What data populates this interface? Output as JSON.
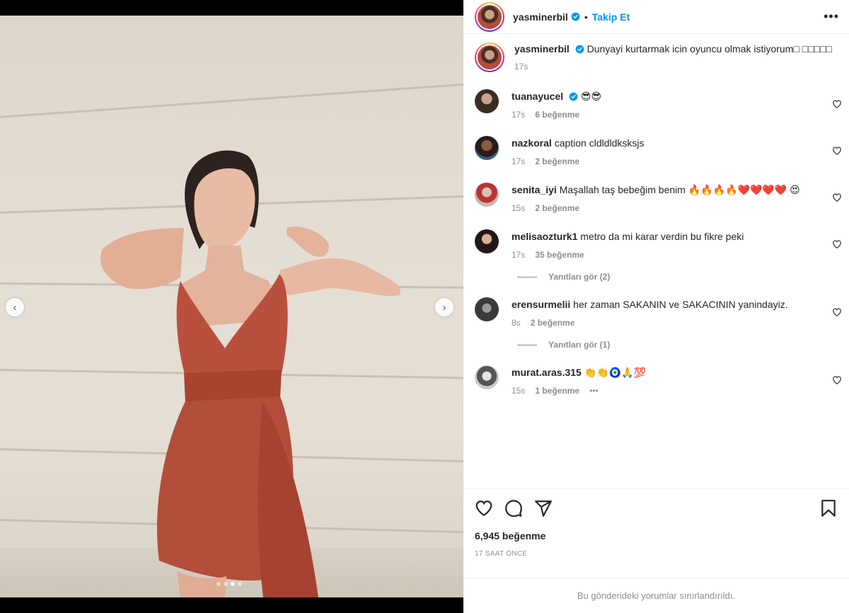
{
  "post": {
    "username": "yasminerbil",
    "follow_label": "Takip Et",
    "separator": "•",
    "more_label": "•••",
    "caption_text": "Dunyayi kurtarmak icin oyuncu olmak istiyorum□ □□□□□",
    "caption_time": "17s"
  },
  "carousel": {
    "prev_icon": "chevron-left-icon",
    "next_icon": "chevron-right-icon",
    "slide_count": 4,
    "active_slide": 3
  },
  "comments": [
    {
      "user": "tuanayucel",
      "verified": true,
      "text": "😎😎",
      "time": "17s",
      "likes": "6 beğenme"
    },
    {
      "user": "nazkoral",
      "verified": false,
      "text": "caption cldldldksksjs",
      "time": "17s",
      "likes": "2 beğenme"
    },
    {
      "user": "senita_iyi",
      "verified": false,
      "text": "Maşallah taş bebeğim benim 🔥🔥🔥🔥❤️❤️❤️❤️ 😍",
      "time": "15s",
      "likes": "2 beğenme"
    },
    {
      "user": "melisaozturk1",
      "verified": false,
      "text": "metro da mi karar verdin bu fikre peki",
      "time": "17s",
      "likes": "35 beğenme",
      "replies": "Yanıtları gör (2)"
    },
    {
      "user": "erensurmelii",
      "verified": false,
      "text": "her zaman SAKANIN ve SAKACININ yanindayiz.",
      "time": "8s",
      "likes": "2 beğenme",
      "replies": "Yanıtları gör (1)"
    },
    {
      "user": "murat.aras.315",
      "verified": false,
      "text": "👏👏🧿🙏💯",
      "time": "15s",
      "likes": "1 beğenme",
      "extra": "•••"
    }
  ],
  "footer": {
    "like_count": "6,945 beğenme",
    "time_ago": "17 SAAT ÖNCE",
    "limited_notice": "Bu gönderideki yorumlar sınırlandırıldı."
  },
  "colors": {
    "accent": "#0095f6",
    "text": "#262626",
    "muted": "#8e8e8e",
    "dress": "#b5503d"
  }
}
